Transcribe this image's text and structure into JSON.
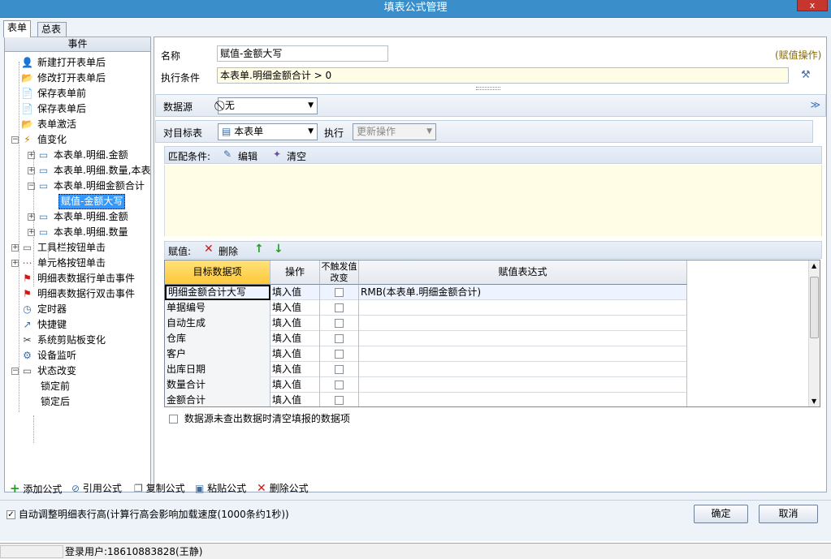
{
  "window": {
    "title": "填表公式管理",
    "close_label": "x"
  },
  "tabs": [
    {
      "label": "表单"
    },
    {
      "label": "总表"
    }
  ],
  "events_panel": {
    "header": "事件",
    "items": [
      {
        "label": "新建打开表单后",
        "icon": "person-icon"
      },
      {
        "label": "修改打开表单后",
        "icon": "folder-icon"
      },
      {
        "label": "保存表单前",
        "icon": "document-icon"
      },
      {
        "label": "保存表单后",
        "icon": "document-icon"
      },
      {
        "label": "表单激活",
        "icon": "folder-icon"
      },
      {
        "label": "值变化",
        "icon": "value-change-icon"
      },
      {
        "label": "本表单.明细.金额",
        "icon": "field-icon"
      },
      {
        "label": "本表单.明细.数量,本表",
        "icon": "field-icon"
      },
      {
        "label": "本表单.明细金额合计",
        "icon": "field-icon"
      },
      {
        "label": "赋值-金额大写",
        "icon": ""
      },
      {
        "label": "本表单.明细.金额",
        "icon": "field-icon"
      },
      {
        "label": "本表单.明细.数量",
        "icon": "field-icon"
      },
      {
        "label": "工具栏按钮单击",
        "icon": "toolbar-icon"
      },
      {
        "label": "单元格按钮单击",
        "icon": "cell-button-icon"
      },
      {
        "label": "明细表数据行单击事件",
        "icon": "flag-icon"
      },
      {
        "label": "明细表数据行双击事件",
        "icon": "flag-icon"
      },
      {
        "label": "定时器",
        "icon": "timer-icon"
      },
      {
        "label": "快捷键",
        "icon": "shortcut-icon"
      },
      {
        "label": "系统剪贴板变化",
        "icon": "scissors-icon"
      },
      {
        "label": "设备监听",
        "icon": "device-icon"
      },
      {
        "label": "状态改变",
        "icon": "state-icon"
      },
      {
        "label": "锁定前",
        "icon": ""
      },
      {
        "label": "锁定后",
        "icon": ""
      }
    ]
  },
  "form": {
    "name_label": "名称",
    "name_value": "赋值-金额大写",
    "type_tag": "(赋值操作)",
    "condition_label": "执行条件",
    "condition_value": "本表单.明细金额合计  > 0",
    "datasource_label": "数据源",
    "datasource_value": "无",
    "target_label": "对目标表",
    "target_value": "本表单",
    "exec_label": "执行",
    "exec_value": "更新操作",
    "match_label": "匹配条件:",
    "edit_label": "编辑",
    "clear_label": "清空",
    "assign_label": "赋值:",
    "delete_label": "删除",
    "up_label": "↑",
    "down_label": "↓"
  },
  "grid": {
    "headers": [
      "目标数据项",
      "操作",
      "不触发值改变",
      "赋值表达式"
    ],
    "rows": [
      {
        "target": "明细金额合计大写",
        "op": "填入值",
        "expr": "RMB(本表单.明细金额合计)"
      },
      {
        "target": "单据编号",
        "op": "填入值",
        "expr": ""
      },
      {
        "target": "自动生成",
        "op": "填入值",
        "expr": ""
      },
      {
        "target": "仓库",
        "op": "填入值",
        "expr": ""
      },
      {
        "target": "客户",
        "op": "填入值",
        "expr": ""
      },
      {
        "target": "出库日期",
        "op": "填入值",
        "expr": ""
      },
      {
        "target": "数量合计",
        "op": "填入值",
        "expr": ""
      },
      {
        "target": "金额合计",
        "op": "填入值",
        "expr": ""
      }
    ]
  },
  "clear_option": {
    "label": "数据源未查出数据时清空填报的数据项",
    "checked": false
  },
  "bottom_toolbar": {
    "add": "添加公式",
    "ref": "引用公式",
    "copy": "复制公式",
    "paste": "粘贴公式",
    "delete": "删除公式"
  },
  "auto_adjust": {
    "label": "自动调整明细表行高(计算行高会影响加载速度(1000条约1秒))",
    "checked": true
  },
  "buttons": {
    "ok": "确定",
    "cancel": "取消"
  },
  "status": {
    "user_label": "登录用户:18610883828(王静)"
  },
  "colors": {
    "title_bar": "#3a8ec9",
    "selection": "#3399ff",
    "condition_bg": "#fffde6",
    "header_highlight": "#ffd24d"
  }
}
